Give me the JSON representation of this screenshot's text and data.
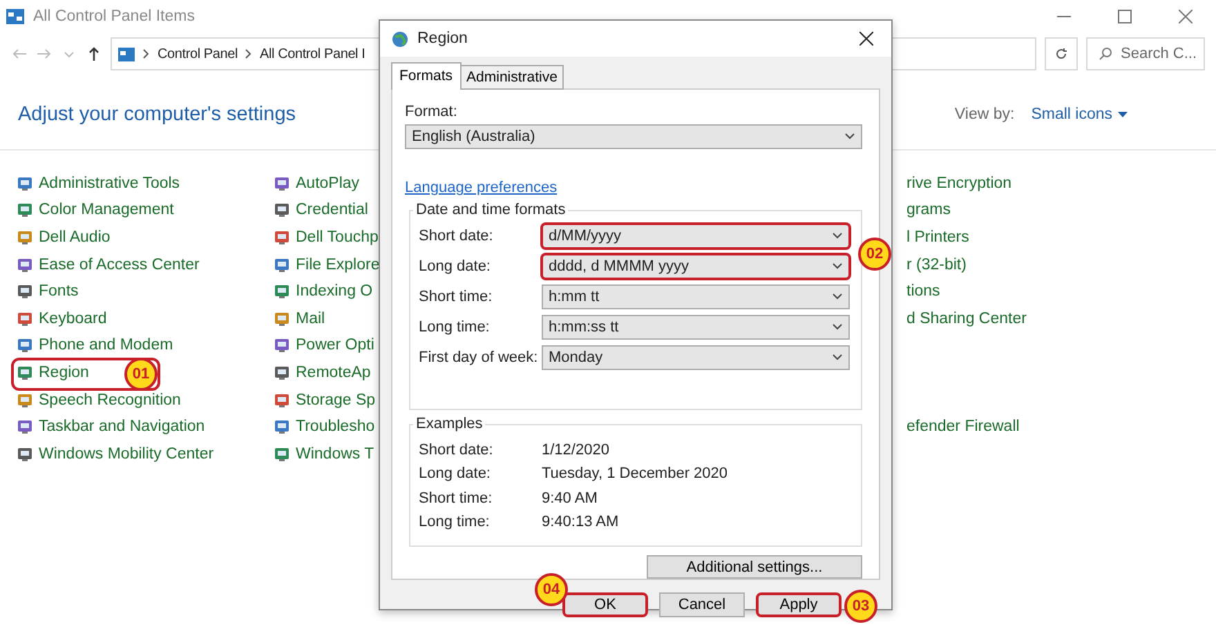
{
  "window": {
    "title": "All Control Panel Items"
  },
  "address_bar": {
    "crumbs": [
      "Control Panel",
      "All Control Panel I"
    ]
  },
  "search": {
    "placeholder": "Search C..."
  },
  "heading": "Adjust your computer's settings",
  "view_by": {
    "label": "View by:",
    "value": "Small icons"
  },
  "columns": [
    [
      {
        "label": "Administrative Tools"
      },
      {
        "label": "Color Management"
      },
      {
        "label": "Dell Audio"
      },
      {
        "label": "Ease of Access Center"
      },
      {
        "label": "Fonts"
      },
      {
        "label": "Keyboard"
      },
      {
        "label": "Phone and Modem"
      },
      {
        "label": "Region",
        "callout": "01"
      },
      {
        "label": "Speech Recognition"
      },
      {
        "label": "Taskbar and Navigation"
      },
      {
        "label": "Windows Mobility Center"
      }
    ],
    [
      {
        "label": "AutoPlay"
      },
      {
        "label": "Credential"
      },
      {
        "label": "Dell Touchp"
      },
      {
        "label": "File Explore"
      },
      {
        "label": "Indexing O"
      },
      {
        "label": "Mail"
      },
      {
        "label": "Power Opti"
      },
      {
        "label": "RemoteAp"
      },
      {
        "label": "Storage Sp"
      },
      {
        "label": "Troublesho"
      },
      {
        "label": "Windows T"
      }
    ],
    [
      {
        "label": "rive Encryption"
      },
      {
        "label": "grams"
      },
      {
        "label": "l Printers"
      },
      {
        "label": "r (32-bit)"
      },
      {
        "label": "tions"
      },
      {
        "label": "d Sharing Center"
      },
      {
        "label": "efender Firewall"
      }
    ]
  ],
  "dialog": {
    "title": "Region",
    "tabs": [
      {
        "label": "Formats",
        "selected": true
      },
      {
        "label": "Administrative",
        "selected": false
      }
    ],
    "format": {
      "label": "Format:",
      "value": "English (Australia)"
    },
    "link": "Language preferences",
    "formats_group": {
      "title": "Date and time formats",
      "callout": "02",
      "rows": [
        {
          "label": "Short date:",
          "value": "d/MM/yyyy",
          "highlighted": true
        },
        {
          "label": "Long date:",
          "value": "dddd, d MMMM yyyy",
          "highlighted": true
        },
        {
          "label": "Short time:",
          "value": "h:mm tt",
          "highlighted": false
        },
        {
          "label": "Long time:",
          "value": "h:mm:ss tt",
          "highlighted": false
        },
        {
          "label": "First day of week:",
          "value": "Monday",
          "highlighted": false
        }
      ]
    },
    "examples": {
      "title": "Examples",
      "rows": [
        {
          "label": "Short date:",
          "value": "1/12/2020"
        },
        {
          "label": "Long date:",
          "value": "Tuesday, 1 December 2020"
        },
        {
          "label": "Short time:",
          "value": "9:40 AM"
        },
        {
          "label": "Long time:",
          "value": "9:40:13 AM"
        }
      ]
    },
    "additional_button": "Additional settings...",
    "buttons": [
      {
        "label": "OK",
        "callout": "04"
      },
      {
        "label": "Cancel"
      },
      {
        "label": "Apply",
        "callout": "03"
      }
    ]
  }
}
